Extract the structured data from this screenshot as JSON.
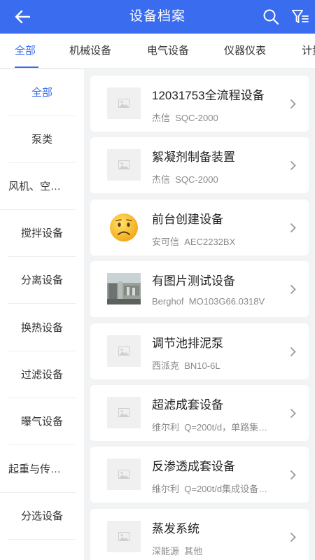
{
  "header": {
    "title": "设备档案",
    "back_icon": "arrow-left-icon",
    "search_icon": "search-icon",
    "filter_icon": "filter-icon"
  },
  "tabs": [
    "全部",
    "机械设备",
    "电气设备",
    "仪器仪表",
    "计量"
  ],
  "active_tab": "全部",
  "sidebar": {
    "items": [
      "全部",
      "泵类",
      "风机、空…",
      "搅拌设备",
      "分离设备",
      "换热设备",
      "过滤设备",
      "曝气设备",
      "起重与传…",
      "分选设备"
    ],
    "active": "全部"
  },
  "devices": [
    {
      "name": "12031753全流程设备",
      "brand": "杰信",
      "model": "SQC-2000",
      "image": "placeholder-image-icon"
    },
    {
      "name": "絮凝剂制备装置",
      "brand": "杰信",
      "model": "SQC-2000",
      "image": "placeholder-image-icon"
    },
    {
      "name": "前台创建设备",
      "brand": "安可信",
      "model": "AEC2232BX",
      "image": "sad-face-emoji-icon"
    },
    {
      "name": "有图片测试设备",
      "brand": "Berghof",
      "model": "MO103G66.0318V",
      "image": "equipment-photo"
    },
    {
      "name": "调节池排泥泵",
      "brand": "西派克",
      "model": "BN10-6L",
      "image": "placeholder-image-icon"
    },
    {
      "name": "超滤成套设备",
      "brand": "维尔利",
      "model": "Q=200t/d，单路集…",
      "image": "placeholder-image-icon"
    },
    {
      "name": "反渗透成套设备",
      "brand": "维尔利",
      "model": "Q=200t/d集成设备…",
      "image": "placeholder-image-icon"
    },
    {
      "name": "蒸发系统",
      "brand": "深能源",
      "model": "其他",
      "image": "placeholder-image-icon"
    }
  ],
  "colors": {
    "primary": "#3a6cf0",
    "background": "#f2f3f5"
  }
}
